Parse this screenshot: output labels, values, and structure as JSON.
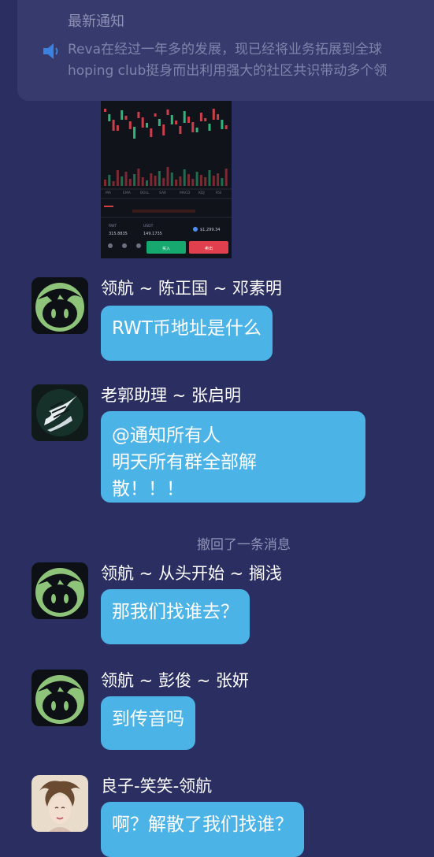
{
  "notice": {
    "title": "最新通知",
    "text_line1": "Reva在经过一年多的发展，现已经将业务拓展到全球",
    "text_line2": "hoping club挺身而出利用强大的社区共识带动多个领",
    "icon": "speaker-icon"
  },
  "screenshot_thumbnail": {
    "tabs": [
      "MA",
      "EMA",
      "BOLL",
      "SAR",
      "MACD",
      "KDJ",
      "RSI"
    ],
    "labels": [
      "RWT",
      "USDT"
    ],
    "values": [
      "315.8835",
      "149.1735"
    ],
    "price": "$1,299.34",
    "buy_label": "买入",
    "sell_label": "卖出"
  },
  "messages": [
    {
      "sender": "领航 ~ 陈正国 ~ 邓素明",
      "text": "RWT币地址是什么",
      "avatar": "green-hair-face-icon"
    },
    {
      "sender": "老郭助理 ~ 张启明",
      "lines": [
        "@通知所有人",
        "明天所有群全部解",
        "散！！！"
      ],
      "avatar": "wing-logo-icon"
    },
    {
      "sender": "领航 ~ 从头开始 ~ 搁浅",
      "text": "那我们找谁去？",
      "avatar": "green-hair-face-icon"
    },
    {
      "sender": "领航 ~ 彭俊 ~ 张妍",
      "text": "到传音吗",
      "avatar": "green-hair-face-icon"
    },
    {
      "sender": "良子-笑笑-领航",
      "text": "啊？解散了我们找谁？",
      "avatar": "woman-portrait-icon"
    }
  ],
  "recall_text": "撤回了一条消息",
  "colors": {
    "background": "#2a2e60",
    "notice_bg": "#363a6c",
    "bubble": "#4cb3e6",
    "avatar_green": "#8ec37a",
    "buy_green": "#17a870",
    "sell_red": "#e0404d"
  }
}
